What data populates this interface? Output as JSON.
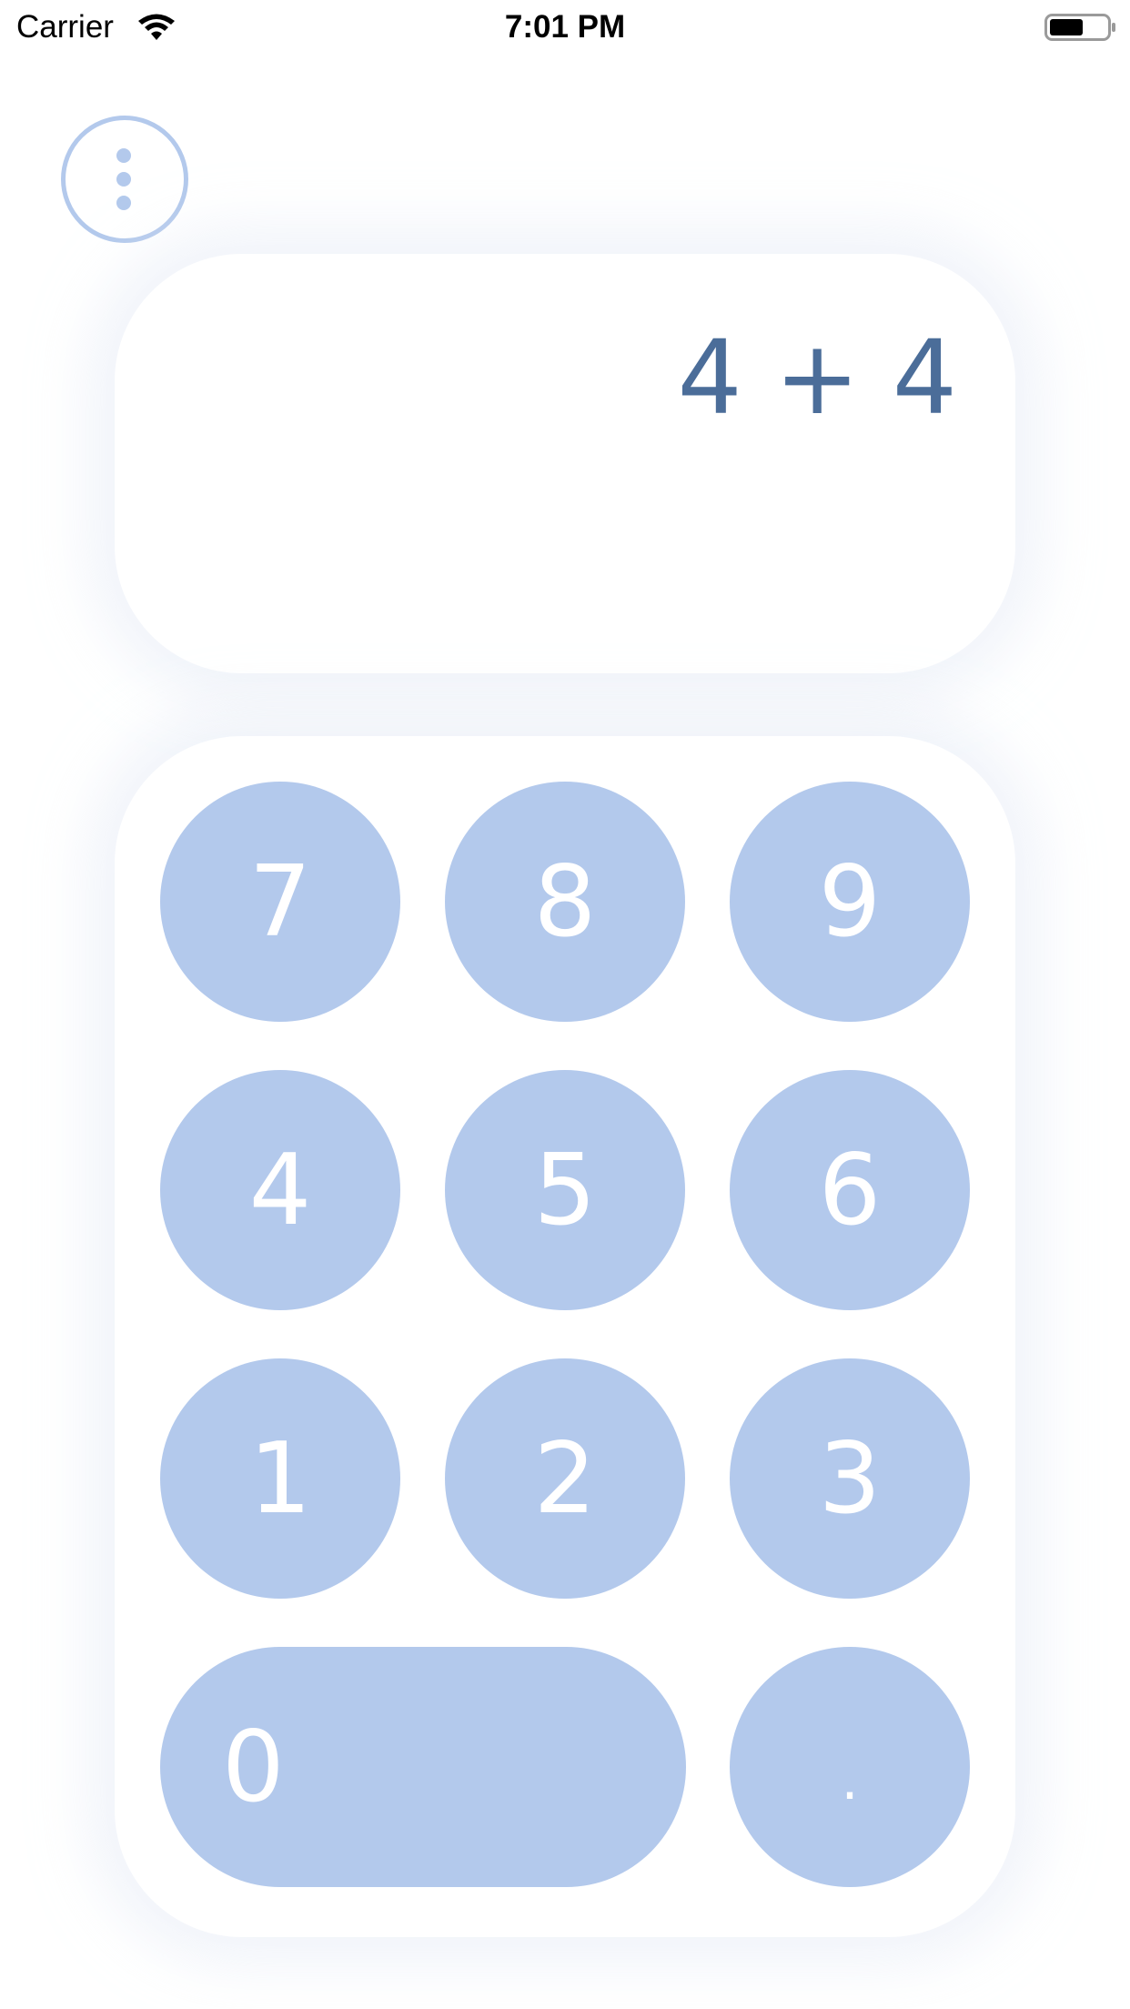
{
  "status_bar": {
    "carrier": "Carrier",
    "time": "7:01 PM",
    "wifi_icon": "wifi-icon",
    "battery_icon": "battery-icon"
  },
  "menu": {
    "icon": "more-vertical-icon"
  },
  "display": {
    "expression": "4 + 4"
  },
  "keypad": {
    "row1": [
      "7",
      "8",
      "9"
    ],
    "row2": [
      "4",
      "5",
      "6"
    ],
    "row3": [
      "1",
      "2",
      "3"
    ],
    "zero": "0",
    "decimal": "."
  },
  "colors": {
    "accent": "#b3c9ec",
    "expression_text": "#4b6d99",
    "key_text": "#ffffff",
    "background": "#ffffff"
  }
}
